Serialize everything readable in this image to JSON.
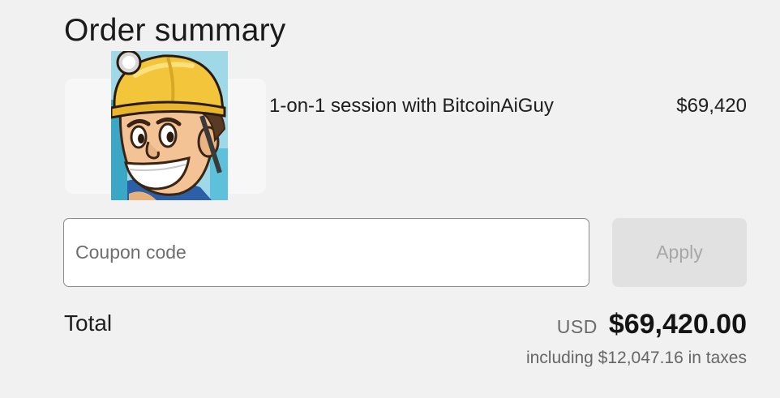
{
  "header": {
    "title": "Order summary"
  },
  "line_item": {
    "name": "1-on-1 session with BitcoinAiGuy",
    "price": "$69,420",
    "image_icon": "cartoon-miner-avatar"
  },
  "coupon": {
    "placeholder": "Coupon code",
    "value": "",
    "apply_label": "Apply"
  },
  "total": {
    "label": "Total",
    "currency": "USD",
    "amount": "$69,420.00",
    "taxes_note": "including $12,047.16 in taxes"
  },
  "colors": {
    "background": "#f1f1f1",
    "text": "#1e1e1e",
    "muted_text": "#666666",
    "disabled_button_bg": "#e1e1e1",
    "disabled_button_text": "#a7a7a7",
    "helmet": "#f2c53a"
  }
}
